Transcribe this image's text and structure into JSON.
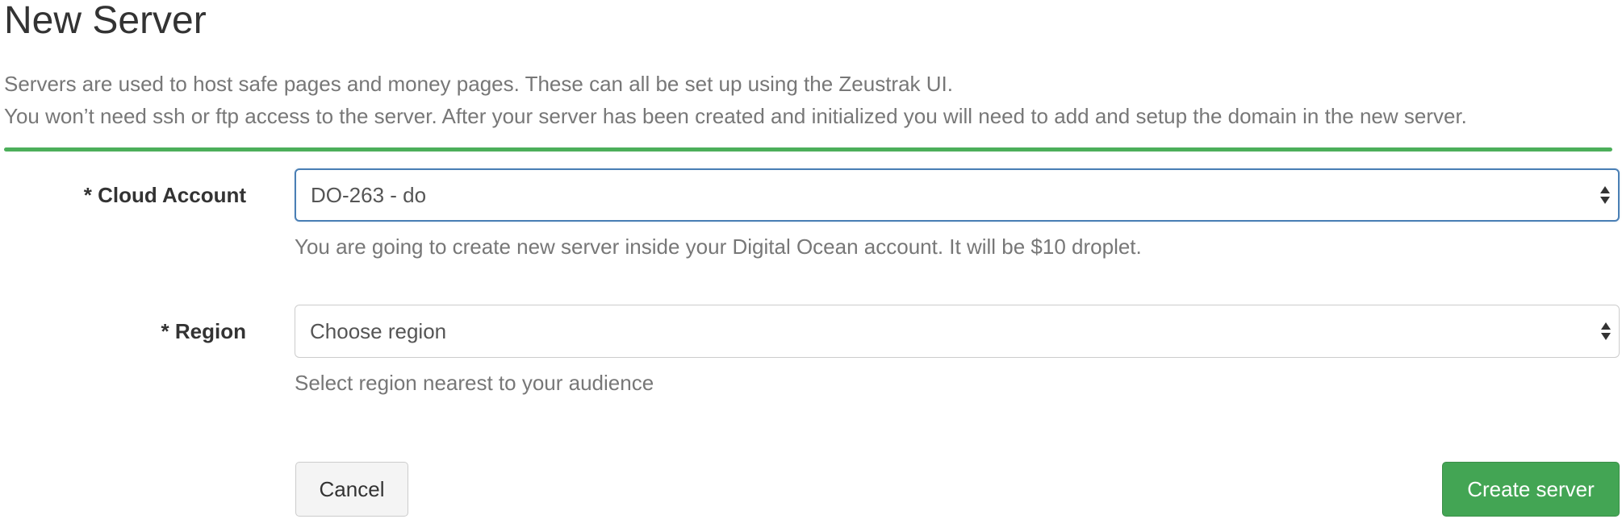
{
  "page": {
    "title": "New Server",
    "intro_line1": "Servers are used to host safe pages and money pages. These can all be set up using the Zeustrak UI.",
    "intro_line2": "You won’t need ssh or ftp access to the server. After your server has been created and initialized you will need to add and setup the domain in the new server."
  },
  "form": {
    "cloud_account": {
      "label": "* Cloud Account",
      "value": "DO-263 - do",
      "help": "You are going to create new server inside your Digital Ocean account. It will be $10 droplet."
    },
    "region": {
      "label": "* Region",
      "value": "Choose region",
      "help": "Select region nearest to your audience"
    }
  },
  "actions": {
    "cancel_label": "Cancel",
    "create_label": "Create server"
  },
  "colors": {
    "accent_green": "#43a554",
    "divider_green": "#4caf5a",
    "focus_blue": "#4a7fb5"
  },
  "icons": {
    "select_arrows": "sort-arrows-icon"
  }
}
